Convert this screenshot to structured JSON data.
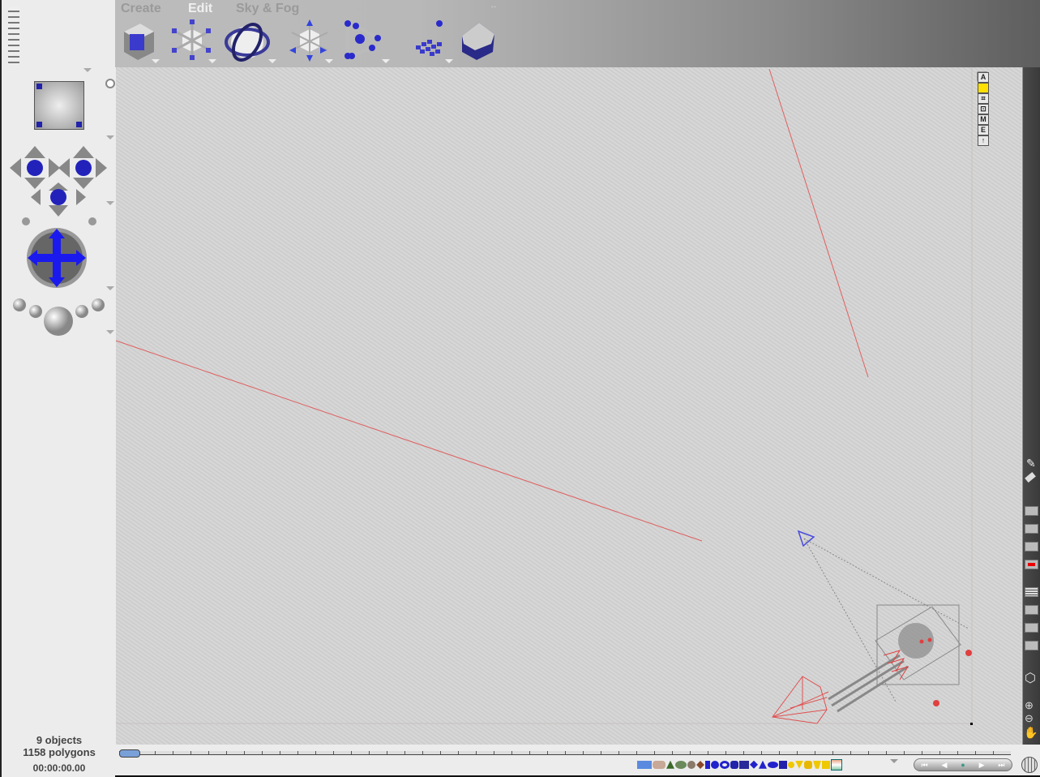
{
  "menus": [
    {
      "label": "Create",
      "active": false
    },
    {
      "label": "Edit",
      "active": true
    },
    {
      "label": "Sky & Fog",
      "active": false
    }
  ],
  "toolbar_icons": [
    "materials-cube-icon",
    "resize-icon",
    "rotate-icon",
    "reposition-icon",
    "align-icon",
    "randomize-icon",
    "terrain-edit-icon"
  ],
  "status": {
    "objects": "9 objects",
    "polygons": "1158 polygons",
    "time": "00:00:00.00"
  },
  "view_buttons": [
    "A",
    "",
    "⌗",
    "⊡",
    "M",
    "E",
    "↑"
  ],
  "colors": {
    "accent": "#2a2aff",
    "selection_red": "#e04040",
    "canvas": "#d4d4d4"
  },
  "left_controls": [
    "nano-preview",
    "camera-cross-controls",
    "trackball",
    "zoom-spheres"
  ],
  "right_tools": [
    "pencil-icon",
    "eraser-icon",
    "wireframe-icon",
    "view-icon",
    "toggle-icon",
    "record-icon",
    "lines-icon",
    "text-icon",
    "frame-icon",
    "grid-menu-icon",
    "cube-icon",
    "zoom-in-icon",
    "zoom-out-icon",
    "hand-icon"
  ],
  "object_palette": [
    "water-plane",
    "stone",
    "terrain",
    "tree",
    "rock",
    "symmetric-lattice",
    "spiral",
    "sphere",
    "torus",
    "cylinder",
    "cube",
    "pyramid",
    "cone",
    "disc",
    "square",
    "yellow-sphere",
    "yellow-cone",
    "yellow-cylinder",
    "yellow-pyramid",
    "yellow-cube",
    "picture-plane"
  ],
  "playback": [
    "rewind",
    "step-back",
    "record",
    "play",
    "fast-forward"
  ]
}
